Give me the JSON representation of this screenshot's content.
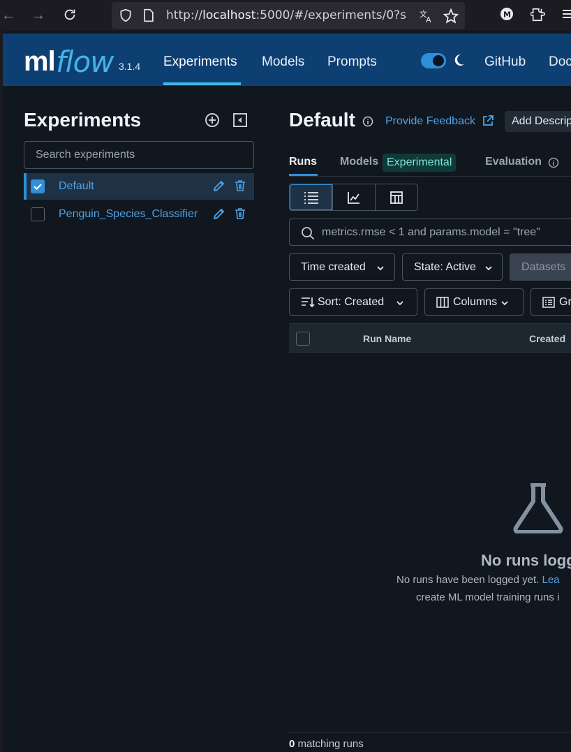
{
  "browser": {
    "url_prefix": "http://",
    "url_host": "localhost",
    "url_rest": ":5000/#/experiments/0?s",
    "profile_initial": "M"
  },
  "header": {
    "logo_ml": "ml",
    "logo_flow": "flow",
    "version": "3.1.4",
    "nav": [
      {
        "label": "Experiments",
        "active": true
      },
      {
        "label": "Models"
      },
      {
        "label": "Prompts"
      },
      {
        "label": "GitHub"
      },
      {
        "label": "Doc"
      }
    ],
    "accent_color": "#43b4e8",
    "bg_color": "#0e3f73"
  },
  "sidebar": {
    "title": "Experiments",
    "search_placeholder": "Search experiments",
    "experiments": [
      {
        "name": "Default",
        "selected": true
      },
      {
        "name": "Penguin_Species_Classifier",
        "selected": false
      }
    ]
  },
  "main": {
    "title": "Default",
    "feedback_label": "Provide Feedback",
    "add_description_label": "Add Descrip",
    "tabs": [
      {
        "label": "Runs",
        "active": true
      },
      {
        "label": "Models"
      },
      {
        "label": "Evaluation"
      }
    ],
    "experimental_badge": "Experimental",
    "filter_placeholder": "metrics.rmse < 1 and params.model = \"tree\"",
    "filters": {
      "time_created": "Time created",
      "state": "State: Active",
      "datasets": "Datasets",
      "sort": "Sort: Created",
      "columns": "Columns",
      "group": "Gr"
    },
    "table_headers": [
      "Run Name",
      "Created"
    ],
    "empty": {
      "title": "No runs logg",
      "line1_text": "No runs have been logged yet. ",
      "line1_link": "Lea",
      "line2_text": "create ML model training runs i"
    },
    "matching_count": "0",
    "matching_label": " matching runs"
  }
}
